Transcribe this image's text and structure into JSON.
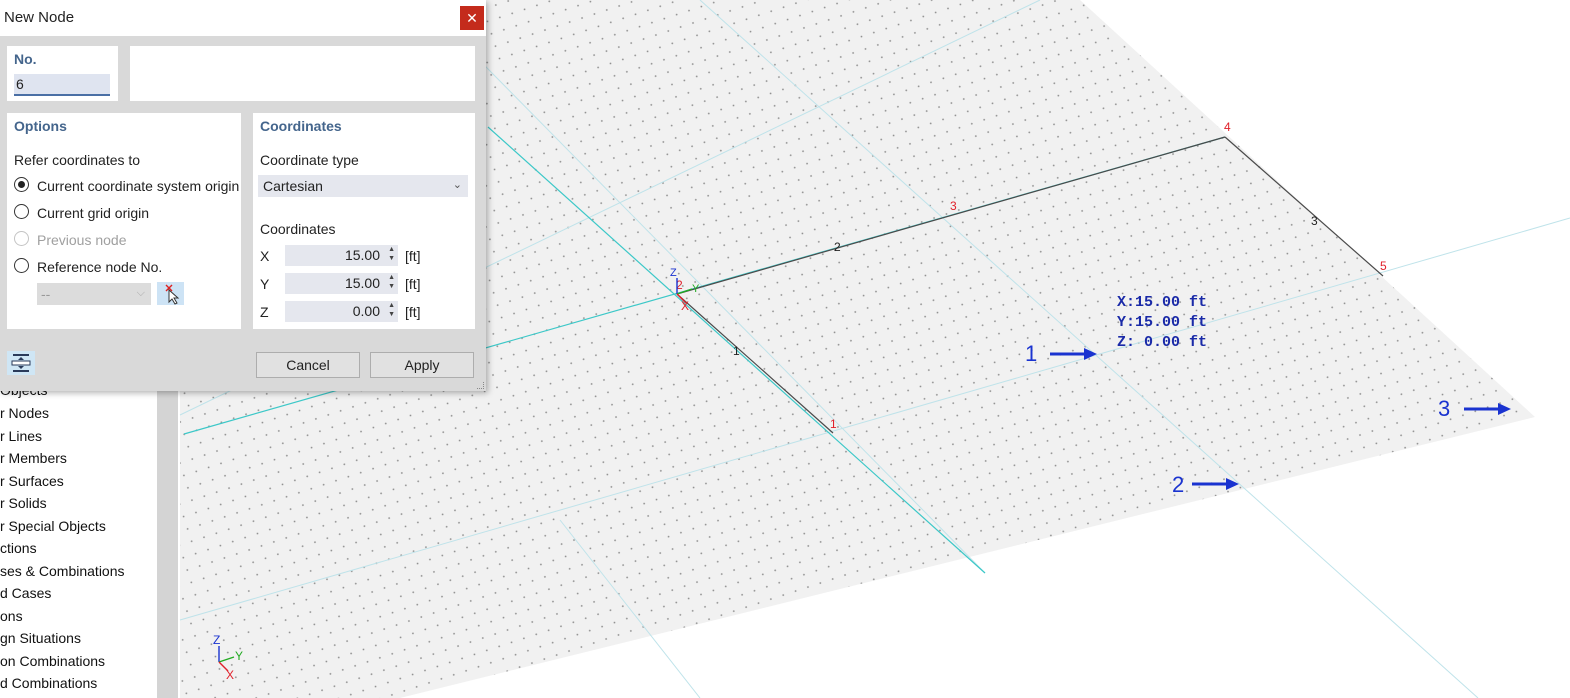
{
  "dialog": {
    "title": "New Node",
    "close_glyph": "✕",
    "number": {
      "label": "No.",
      "value": "6"
    },
    "comment_value": "",
    "options": {
      "title": "Options",
      "refer_label": "Refer coordinates to",
      "radios": [
        {
          "label": "Current coordinate system origin",
          "checked": true,
          "enabled": true
        },
        {
          "label": "Current grid origin",
          "checked": false,
          "enabled": true
        },
        {
          "label": "Previous node",
          "checked": false,
          "enabled": false
        },
        {
          "label": "Reference node No.",
          "checked": false,
          "enabled": true
        }
      ],
      "reference_node_value": "--"
    },
    "coordinates": {
      "title": "Coordinates",
      "type_label": "Coordinate type",
      "type_value": "Cartesian",
      "coords_label": "Coordinates",
      "rows": [
        {
          "axis": "X",
          "value": "15.00",
          "unit": "[ft]"
        },
        {
          "axis": "Y",
          "value": "15.00",
          "unit": "[ft]"
        },
        {
          "axis": "Z",
          "value": "0.00",
          "unit": "[ft]"
        }
      ]
    },
    "buttons": {
      "cancel": "Cancel",
      "apply": "Apply"
    },
    "icons": {
      "extra": "distribute-icon",
      "pick": "pick-node-icon"
    }
  },
  "navigator": {
    "items": [
      "Objects",
      "r Nodes",
      "r Lines",
      "r Members",
      "r Surfaces",
      "r Solids",
      "r Special Objects",
      "ctions",
      "ses & Combinations",
      "d Cases",
      "ons",
      "gn Situations",
      "on Combinations",
      "d Combinations"
    ]
  },
  "viewport": {
    "node_labels": [
      "1",
      "2",
      "3",
      "4",
      "5"
    ],
    "line_labels": [
      "1",
      "2",
      "3"
    ],
    "origin_axes": {
      "x": "X",
      "y": "Y",
      "z": "Z",
      "node": "2"
    },
    "coordinate_tooltip": [
      "X:15.00 ft",
      "Y:15.00 ft",
      "Z: 0.00 ft"
    ],
    "callouts": [
      "1",
      "2",
      "3"
    ],
    "corner_axes": {
      "x": "X",
      "y": "Y",
      "z": "Z"
    },
    "colors": {
      "node_label": "#e0202a",
      "line_label": "#222222",
      "grid_line": "#3cc8c8",
      "callout": "#1a33d0",
      "tooltip": "#1a2aa8"
    }
  }
}
